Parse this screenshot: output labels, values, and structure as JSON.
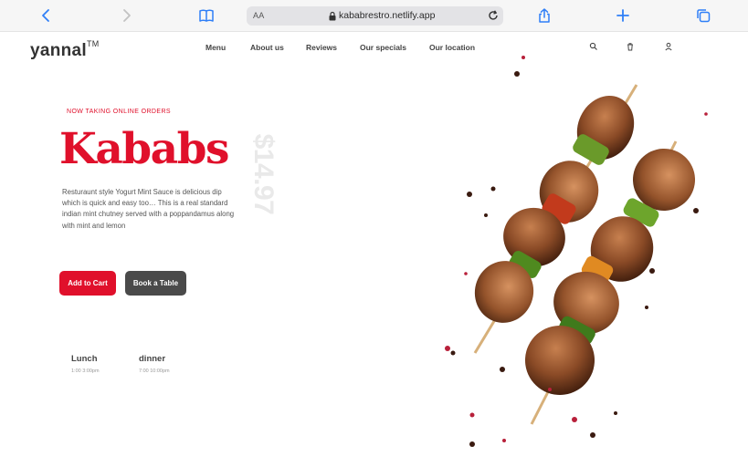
{
  "browser": {
    "text_size_label": "AA",
    "url": "kababrestro.netlify.app"
  },
  "site": {
    "logo": "yannal",
    "logo_mark": "TM",
    "nav": [
      "Menu",
      "About us",
      "Reviews",
      "Our specials",
      "Our location"
    ],
    "eyebrow": "NOW TAKING ONLINE ORDERS",
    "title": "Kababs",
    "price": "$14.97",
    "description": "Resturaunt style Yogurt Mint Sauce is delicious dip which is quick and easy too… This is a real standard indian mint chutney served with a poppandamus along with mint and lemon",
    "add_to_cart": "Add to Cart",
    "book_table": "Book a Table",
    "hours": [
      {
        "label": "Lunch",
        "time": "1:00  3:00pm"
      },
      {
        "label": "dinner",
        "time": "7:00  10:00pm"
      }
    ]
  },
  "colors": {
    "accent": "#e0102b",
    "dark_button": "#4a4a4a",
    "browser_blue": "#2f7ff7"
  },
  "icons": [
    "back-icon",
    "forward-icon",
    "bookmarks-icon",
    "lock-icon",
    "reload-icon",
    "share-icon",
    "new-tab-icon",
    "tabs-icon",
    "search-icon",
    "trash-icon",
    "user-icon"
  ]
}
